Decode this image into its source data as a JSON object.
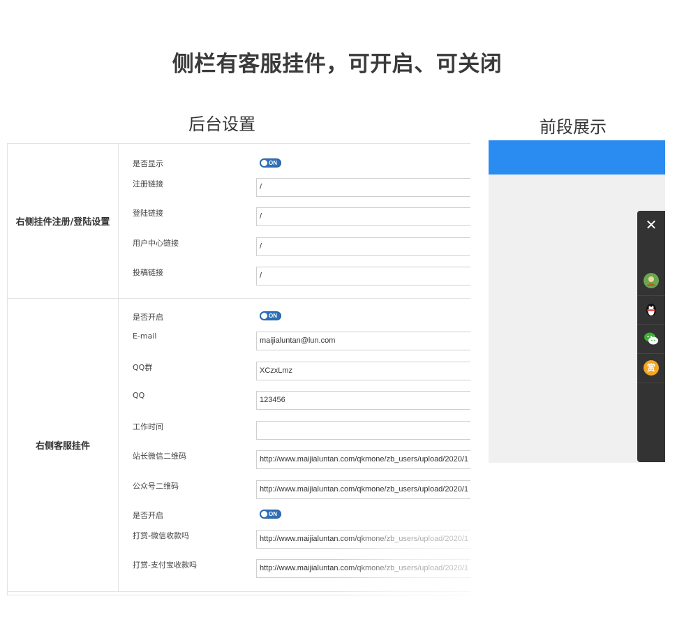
{
  "main_title": "侧栏有客服挂件，可开启、可关闭",
  "left_title": "后台设置",
  "right_title": "前段展示",
  "section1": {
    "label": "右侧挂件注册/登陆设置",
    "rows": {
      "show_label": "是否显示",
      "show_toggle": "ON",
      "register_label": "注册链接",
      "register_value": "/",
      "login_label": "登陆链接",
      "login_value": "/",
      "user_center_label": "用户中心链接",
      "user_center_value": "/",
      "submit_label": "投稿链接",
      "submit_value": "/"
    }
  },
  "section2": {
    "label": "右侧客服挂件",
    "rows": {
      "enable_label": "是否开启",
      "enable_toggle": "ON",
      "email_label": "E-mail",
      "email_value": "maijialuntan@lun.com",
      "qqgroup_label": "QQ群",
      "qqgroup_value": "XCzxLmz",
      "qq_label": "QQ",
      "qq_value": "123456",
      "worktime_label": "工作时间",
      "worktime_value": "",
      "wechat_qr_label": "站长微信二维码",
      "wechat_qr_value": "http://www.maijialuntan.com/qkmone/zb_users/upload/2020/1",
      "mp_qr_label": "公众号二维码",
      "mp_qr_value": "http://www.maijialuntan.com/qkmone/zb_users/upload/2020/1",
      "reward_enable_label": "是否开启",
      "reward_enable_toggle": "ON",
      "reward_wechat_label": "打赏-微信收款吗",
      "reward_wechat_value": "http://www.maijialuntan.com/qkmone/zb_users/upload/2020/1",
      "reward_alipay_label": "打赏-支付宝收款吗",
      "reward_alipay_value": "http://www.maijialuntan.com/qkmone/zb_users/upload/2020/1"
    }
  },
  "sidebar": {
    "close_glyph": "✕",
    "reward_glyph": "赏",
    "icons": [
      "avatar-icon",
      "qq-penguin-icon",
      "wechat-icon",
      "reward-icon"
    ]
  },
  "colors": {
    "toggle": "#2f6fb6",
    "preview_bar": "#2a8cf0",
    "sidebar": "#333333",
    "reward": "#f5a623",
    "wechat": "#3cb034"
  }
}
